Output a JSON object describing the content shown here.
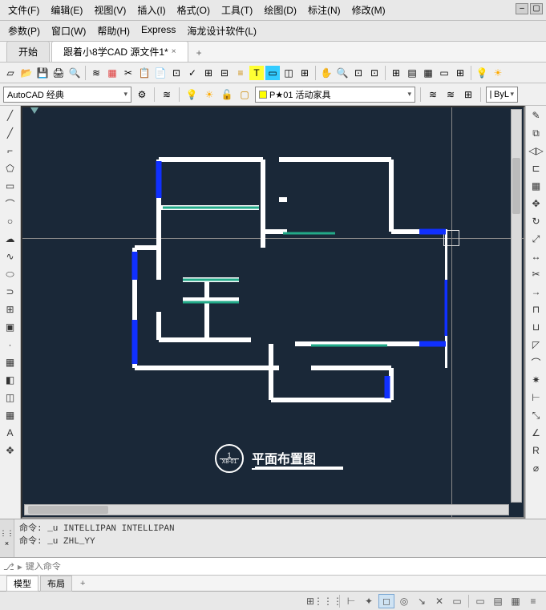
{
  "menu": {
    "items": [
      "文件(F)",
      "编辑(E)",
      "视图(V)",
      "插入(I)",
      "格式(O)",
      "工具(T)",
      "绘图(D)",
      "标注(N)",
      "修改(M)"
    ],
    "items2": [
      "参数(P)",
      "窗口(W)",
      "帮助(H)",
      "Express",
      "海龙设计软件(L)"
    ]
  },
  "tabs": {
    "start": "开始",
    "file": "跟着小8学CAD 源文件1*"
  },
  "workspace": {
    "combo": "AutoCAD 经典"
  },
  "layer": {
    "name": "P★01 活动家具",
    "color_label": "ByL"
  },
  "drawing_title": {
    "main": "平面布置图",
    "num_top": "1",
    "num_bottom": "X8-01"
  },
  "cmd": {
    "line1": "命令: _u INTELLIPAN INTELLIPAN",
    "line2": "命令: _u ZHL_YY",
    "placeholder": "键入命令"
  },
  "model_tabs": {
    "model": "模型",
    "layout": "布局"
  }
}
